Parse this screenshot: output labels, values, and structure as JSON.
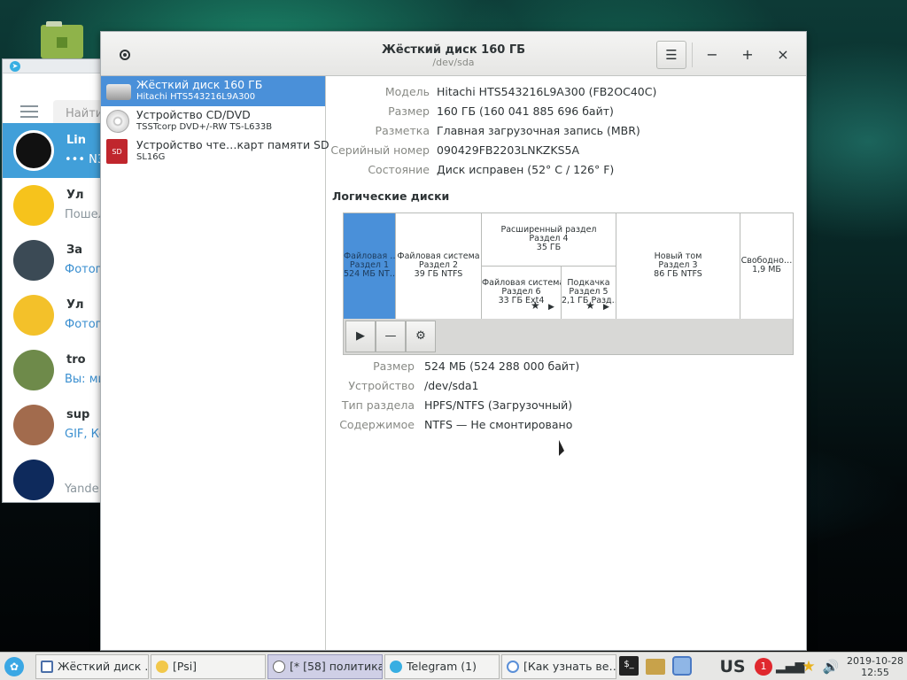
{
  "telegram": {
    "search_placeholder": "Найти",
    "chats": [
      {
        "name": "Lin",
        "preview": "••• N3",
        "active": true
      },
      {
        "name": "Ул",
        "preview": "Пошел"
      },
      {
        "name": "За",
        "preview": "Фотогр"
      },
      {
        "name": "Ул",
        "preview": "Фотогр"
      },
      {
        "name": "tro",
        "preview": "Вы: ми"
      },
      {
        "name": "sup",
        "preview": "GIF, Ко"
      },
      {
        "name": "",
        "preview": "Yande"
      }
    ]
  },
  "disks": {
    "title": "Жёсткий диск 160 ГБ",
    "subtitle": "/dev/sda",
    "header_buttons": {
      "menu": "☰",
      "minimize": "−",
      "maximize": "+",
      "close": "×"
    },
    "devices": [
      {
        "name": "Жёсткий диск 160 ГБ",
        "sub": "Hitachi HTS543216L9A300",
        "icon": "hard-disk-icon",
        "selected": true
      },
      {
        "name": "Устройство CD/DVD",
        "sub": "TSSTcorp DVD+/-RW TS-L633B",
        "icon": "optical-drive-icon"
      },
      {
        "name": "Устройство чте…карт памяти SD",
        "sub": "SL16G",
        "icon": "sd-card-icon"
      }
    ],
    "drive_info": {
      "model_label": "Модель",
      "model": "Hitachi HTS543216L9A300 (FB2OC40C)",
      "size_label": "Размер",
      "size": "160 ГБ (160 041 885 696 байт)",
      "partitioning_label": "Разметка",
      "partitioning": "Главная загрузочная запись (MBR)",
      "serial_label": "Серийный номер",
      "serial": "090429FB2203LNKZKS5A",
      "state_label": "Состояние",
      "state": "Диск исправен (52° C / 126° F)"
    },
    "volumes_title": "Логические диски",
    "partitions": [
      {
        "l1": "Файловая …",
        "l2": "Раздел 1",
        "l3": "524 МБ NT…",
        "selected": true
      },
      {
        "l1": "Файловая система",
        "l2": "Раздел 2",
        "l3": "39 ГБ NTFS"
      },
      {
        "l1": "Расширенный раздел",
        "l2": "Раздел 4",
        "l3": "35 ГБ"
      },
      {
        "l1": "Файловая система",
        "l2": "Раздел 6",
        "l3": "33 ГБ Ext4"
      },
      {
        "l1": "Подкачка",
        "l2": "Раздел 5",
        "l3": "2,1 ГБ Разд…"
      },
      {
        "l1": "Новый том",
        "l2": "Раздел 3",
        "l3": "86 ГБ NTFS"
      },
      {
        "l1": "Свободно…",
        "l2": "1,9 МБ",
        "l3": ""
      }
    ],
    "partition_info": {
      "size_label": "Размер",
      "size": "524 МБ (524 288 000 байт)",
      "device_label": "Устройство",
      "device": "/dev/sda1",
      "type_label": "Тип раздела",
      "type": "HPFS/NTFS (Загрузочный)",
      "contents_label": "Содержимое",
      "contents": "NTFS — Не смонтировано"
    },
    "tools": {
      "play": "▶",
      "remove": "—",
      "gear": "⚙"
    }
  },
  "taskbar": {
    "tasks": [
      {
        "label": "Жёсткий диск …"
      },
      {
        "label": "[Psi]"
      },
      {
        "label": "[* [58] политика]",
        "active": true
      },
      {
        "label": "Telegram (1)"
      },
      {
        "label": "[Как узнать ве…"
      }
    ],
    "keyboard_layout": "US",
    "notification_count": "1",
    "date": "2019-10-28",
    "time": "12:55"
  }
}
